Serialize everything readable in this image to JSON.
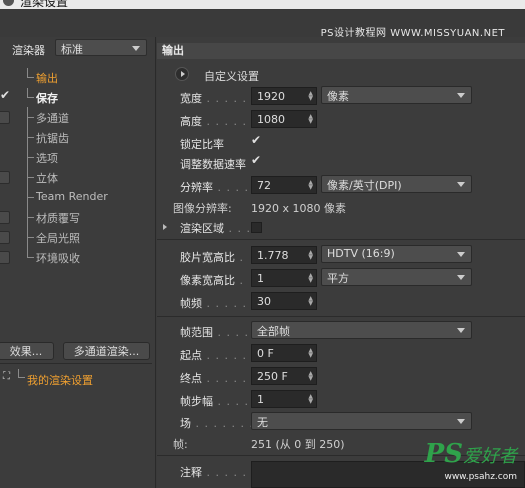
{
  "window": {
    "title": "渲染设置"
  },
  "watermark_top": "PS设计教程网 WWW.MISSYUAN.NET",
  "left": {
    "renderer_label": "渲染器",
    "renderer_value": "标准",
    "tree": [
      {
        "label": "输出",
        "checked": false,
        "state": "active"
      },
      {
        "label": "保存",
        "checked": true,
        "state": "selected"
      },
      {
        "label": "多通道",
        "checked": false,
        "state": ""
      },
      {
        "label": "抗锯齿",
        "checked": false,
        "state": ""
      },
      {
        "label": "选项",
        "checked": false,
        "state": ""
      },
      {
        "label": "立体",
        "checked": false,
        "state": ""
      },
      {
        "label": "Team Render",
        "checked": false,
        "state": ""
      },
      {
        "label": "材质覆写",
        "checked": false,
        "state": ""
      },
      {
        "label": "全局光照",
        "checked": false,
        "state": ""
      },
      {
        "label": "环境吸收",
        "checked": false,
        "state": ""
      }
    ],
    "effects_button": "效果...",
    "multipass_button": "多通道渲染...",
    "preset_label": "我的渲染设置"
  },
  "right": {
    "section_title": "输出",
    "preset_name": "自定义设置",
    "width_label": "宽度",
    "width_value": "1920",
    "unit_value": "像素",
    "height_label": "高度",
    "height_value": "1080",
    "lock_ratio_label": "锁定比率",
    "adjust_rate_label": "调整数据速率",
    "resolution_label": "分辨率",
    "resolution_value": "72",
    "resolution_unit": "像素/英寸(DPI)",
    "image_res_label": "图像分辨率:",
    "image_res_value": "1920 x 1080 像素",
    "render_region_label": "渲染区域",
    "film_aspect_label": "胶片宽高比",
    "film_aspect_value": "1.778",
    "film_aspect_preset": "HDTV (16:9)",
    "pixel_aspect_label": "像素宽高比",
    "pixel_aspect_value": "1",
    "pixel_aspect_preset": "平方",
    "fps_label": "帧频",
    "fps_value": "30",
    "frame_range_label": "帧范围",
    "frame_range_value": "全部帧",
    "start_label": "起点",
    "start_value": "0 F",
    "end_label": "终点",
    "end_value": "250 F",
    "frame_step_label": "帧步幅",
    "frame_step_value": "1",
    "field_label": "场",
    "field_value": "无",
    "frames_label": "帧:",
    "frames_value": "251 (从 0 到 250)",
    "notes_label": "注释"
  },
  "watermark_bottom": {
    "ps": "PS",
    "cn": "爱好者",
    "url": "www.psahz.com"
  }
}
